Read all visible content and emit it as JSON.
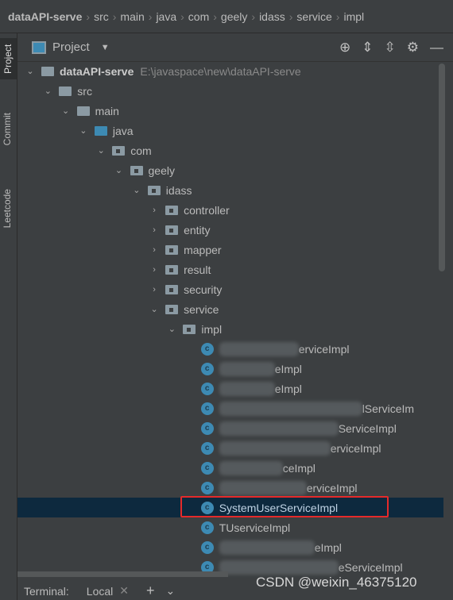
{
  "breadcrumb": [
    "dataAPI-serve",
    "src",
    "main",
    "java",
    "com",
    "geely",
    "idass",
    "service",
    "impl"
  ],
  "side_tabs": [
    "Project",
    "Commit",
    "Leetcode"
  ],
  "panel": {
    "title": "Project",
    "tools": [
      "locate-icon",
      "expand-all-icon",
      "collapse-all-icon",
      "gear-icon",
      "minimize-icon"
    ]
  },
  "tree": [
    {
      "label": "dataAPI-serve",
      "path": "E:\\javaspace\\new\\dataAPI-serve",
      "level": 0,
      "type": "module",
      "open": true
    },
    {
      "label": "src",
      "level": 1,
      "type": "folder",
      "open": true
    },
    {
      "label": "main",
      "level": 2,
      "type": "folder",
      "open": true
    },
    {
      "label": "java",
      "level": 3,
      "type": "src",
      "open": true
    },
    {
      "label": "com",
      "level": 4,
      "type": "package",
      "open": true
    },
    {
      "label": "geely",
      "level": 5,
      "type": "package",
      "open": true
    },
    {
      "label": "idass",
      "level": 6,
      "type": "package",
      "open": true
    },
    {
      "label": "controller",
      "level": 7,
      "type": "package",
      "open": false
    },
    {
      "label": "entity",
      "level": 7,
      "type": "package",
      "open": false
    },
    {
      "label": "mapper",
      "level": 7,
      "type": "package",
      "open": false
    },
    {
      "label": "result",
      "level": 7,
      "type": "package",
      "open": false
    },
    {
      "label": "security",
      "level": 7,
      "type": "package",
      "open": false
    },
    {
      "label": "service",
      "level": 7,
      "type": "package",
      "open": true
    },
    {
      "label": "impl",
      "level": 8,
      "type": "package",
      "open": true
    },
    {
      "label": "erviceImpl",
      "level": 9,
      "type": "class",
      "blurred": true
    },
    {
      "label": "eImpl",
      "level": 9,
      "type": "class",
      "blurred": true
    },
    {
      "label": "eImpl",
      "level": 9,
      "type": "class",
      "blurred": true
    },
    {
      "label": "lServiceIm",
      "level": 9,
      "type": "class",
      "blurred": true
    },
    {
      "label": "ServiceImpl",
      "level": 9,
      "type": "class",
      "blurred": true
    },
    {
      "label": "erviceImpl",
      "level": 9,
      "type": "class",
      "blurred": true
    },
    {
      "label": "ceImpl",
      "level": 9,
      "type": "class",
      "blurred": true
    },
    {
      "label": "erviceImpl",
      "level": 9,
      "type": "class",
      "blurred": true
    },
    {
      "label": "SystemUserServiceImpl",
      "level": 9,
      "type": "class",
      "selected": true
    },
    {
      "label": "TUserviceImpl",
      "level": 9,
      "type": "class"
    },
    {
      "label": "eImpl",
      "level": 9,
      "type": "class",
      "blurred": true
    },
    {
      "label": "eServiceImpl",
      "level": 9,
      "type": "class",
      "blurred": true
    }
  ],
  "class_icon_letter": "c",
  "terminal": {
    "label": "Terminal:",
    "tab": "Local"
  },
  "watermark": "CSDN @weixin_46375120",
  "colors": {
    "selection": "#0d293e",
    "highlight": "#e52a2a",
    "accent": "#3d8ab3"
  }
}
